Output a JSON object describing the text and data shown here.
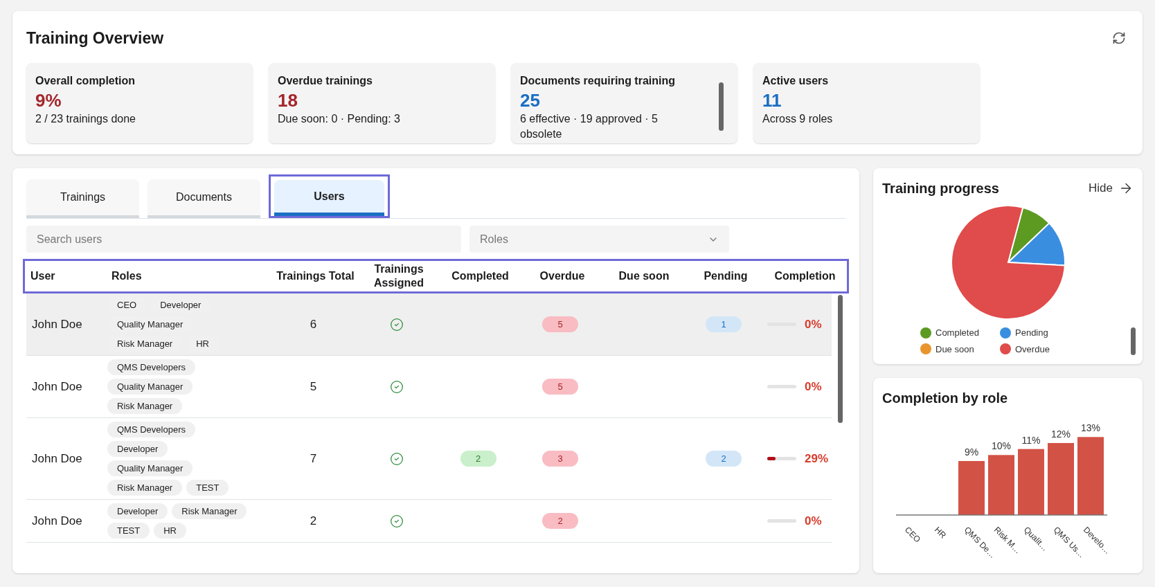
{
  "overview": {
    "title": "Training Overview",
    "stats": [
      {
        "label": "Overall completion",
        "value": "9%",
        "color": "#a4262c",
        "detail": "2 / 23 trainings done",
        "scrollbar": false
      },
      {
        "label": "Overdue trainings",
        "value": "18",
        "color": "#a4262c",
        "detail": "Due soon: 0 · Pending: 3",
        "scrollbar": false
      },
      {
        "label": "Documents requiring training",
        "value": "25",
        "color": "#1a6fc4",
        "detail": "6 effective · 19 approved · 5 obsolete",
        "scrollbar": true
      },
      {
        "label": "Active users",
        "value": "11",
        "color": "#1a6fc4",
        "detail": "Across 9 roles",
        "scrollbar": false
      }
    ]
  },
  "tabs": [
    {
      "label": "Trainings",
      "selected": false
    },
    {
      "label": "Documents",
      "selected": false
    },
    {
      "label": "Users",
      "selected": true
    }
  ],
  "search": {
    "placeholder": "Search users"
  },
  "roles_filter": {
    "placeholder": "Roles"
  },
  "table": {
    "columns": [
      "User",
      "Roles",
      "Trainings Total",
      "Trainings Assigned",
      "Completed",
      "Overdue",
      "Due soon",
      "Pending",
      "Completion"
    ],
    "rows": [
      {
        "user": "John Doe",
        "roles": [
          "CEO",
          "Developer",
          "Quality Manager",
          "Risk Manager",
          "HR"
        ],
        "total": "6",
        "assigned": true,
        "completed": null,
        "overdue": "5",
        "due_soon": null,
        "pending": "1",
        "level": 0,
        "completion": "0%",
        "selected": true
      },
      {
        "user": "John Doe",
        "roles": [
          "QMS Developers",
          "Quality Manager",
          "Risk Manager"
        ],
        "total": "5",
        "assigned": true,
        "completed": null,
        "overdue": "5",
        "due_soon": null,
        "pending": null,
        "level": 0,
        "completion": "0%",
        "selected": false
      },
      {
        "user": "John Doe",
        "roles": [
          "QMS Developers",
          "Developer",
          "Quality Manager",
          "Risk Manager",
          "TEST"
        ],
        "total": "7",
        "assigned": true,
        "completed": "2",
        "overdue": "3",
        "due_soon": null,
        "pending": "2",
        "level": 0.29,
        "completion": "29%",
        "selected": false
      },
      {
        "user": "John Doe",
        "roles": [
          "Developer",
          "Risk Manager",
          "TEST",
          "HR"
        ],
        "total": "2",
        "assigned": true,
        "completed": null,
        "overdue": "2",
        "due_soon": null,
        "pending": null,
        "level": 0,
        "completion": "0%",
        "selected": false
      }
    ]
  },
  "progress": {
    "title": "Training progress",
    "hide_label": "Hide",
    "chart_data": {
      "type": "pie",
      "categories": [
        "Completed",
        "Pending",
        "Due soon",
        "Overdue"
      ],
      "values": [
        8.7,
        13.0,
        0,
        78.3
      ],
      "colors": [
        "#5c9a22",
        "#3a8ee0",
        "#e8952e",
        "#e04b4b"
      ]
    }
  },
  "by_role": {
    "title": "Completion by role",
    "chart_data": {
      "type": "bar",
      "categories": [
        "CEO",
        "HR",
        "QMS De…",
        "Risk M…",
        "Qualit…",
        "QMS Us…",
        "Develo…"
      ],
      "color": "#d35246",
      "values": [
        null,
        null,
        9,
        10,
        11,
        12,
        13
      ],
      "value_labels": [
        null,
        null,
        "9%",
        "10%",
        "11%",
        "12%",
        "13%"
      ]
    }
  }
}
